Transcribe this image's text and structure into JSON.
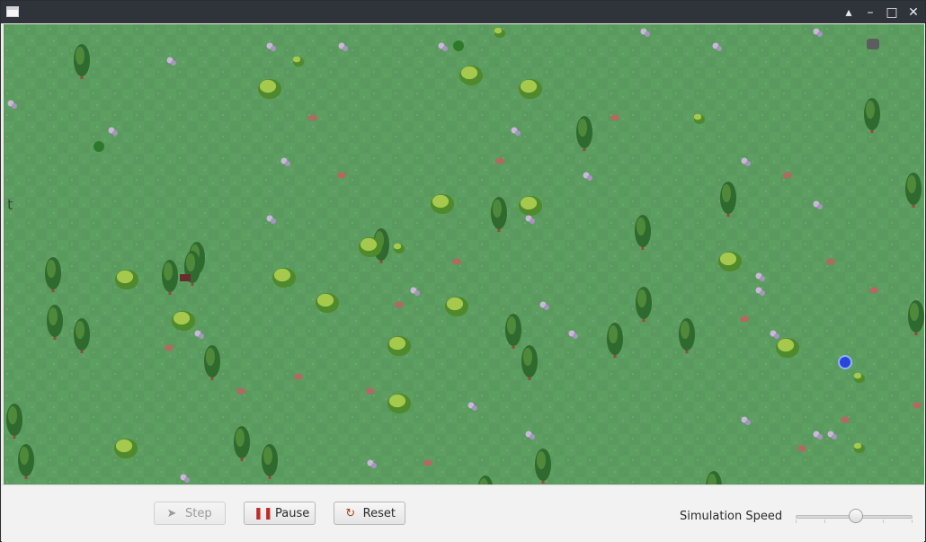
{
  "window": {
    "title": "",
    "controls": [
      "shade-icon",
      "minimize-icon",
      "maximize-icon",
      "close-icon"
    ]
  },
  "simulation": {
    "background": "#5d9e61",
    "entities": {
      "trees": 28,
      "bushes": 22,
      "flowers": 30,
      "rocks": 18,
      "turtles": 2,
      "spiders": 1,
      "portals": 1
    }
  },
  "toolbar": {
    "step_label": "Step",
    "pause_label": "Pause",
    "reset_label": "Reset",
    "step_enabled": false
  },
  "speed": {
    "label": "Simulation Speed",
    "value_fraction": 0.52
  },
  "colors": {
    "grass": "#5d9e61",
    "titlebar": "#2f343a",
    "pause_icon": "#c12a2a",
    "reset_icon": "#a04a1a"
  }
}
